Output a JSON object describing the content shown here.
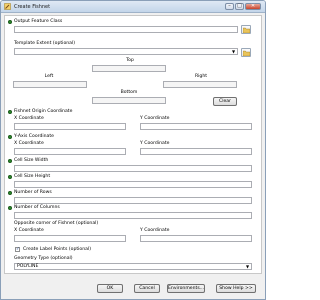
{
  "window": {
    "title": "Create Fishnet"
  },
  "labels": {
    "output_feature_class": "Output Feature Class",
    "template_extent": "Template Extent (optional)",
    "top": "Top",
    "left": "Left",
    "right": "Right",
    "bottom": "Bottom",
    "origin": "Fishnet Origin Coordinate",
    "origin_x": "X Coordinate",
    "origin_y": "Y Coordinate",
    "yaxis": "Y-Axis Coordinate",
    "yaxis_x": "X Coordinate",
    "yaxis_y": "Y Coordinate",
    "cell_width": "Cell Size Width",
    "cell_height": "Cell Size Height",
    "rows": "Number of Rows",
    "columns": "Number of Columns",
    "opposite": "Opposite corner of Fishnet (optional)",
    "opposite_x": "X Coordinate",
    "opposite_y": "Y Coordinate",
    "create_label_points": "Create Label Points (optional)",
    "geometry_type": "Geometry Type (optional)"
  },
  "values": {
    "geometry_type": "POLYLINE",
    "create_label_points_checked": true
  },
  "buttons": {
    "clear": "Clear",
    "ok": "OK",
    "cancel": "Cancel",
    "environments": "Environments...",
    "show_help": "Show Help >>"
  },
  "colors": {
    "required_dot": "#2f8f2f",
    "title_bar": "#c3d5ea"
  }
}
